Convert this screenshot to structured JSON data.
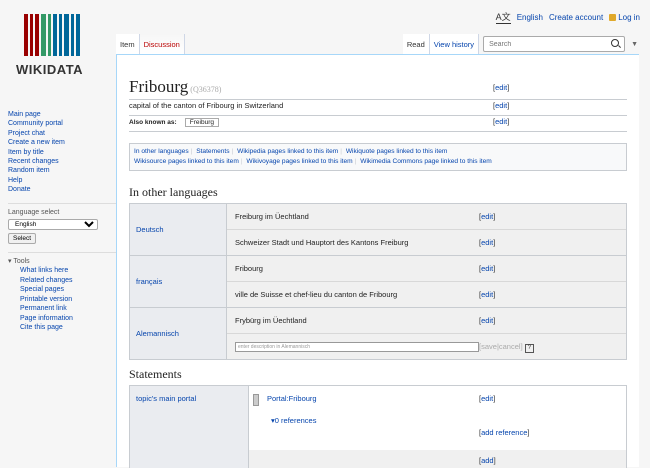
{
  "personal": {
    "language": "English",
    "create_account": "Create account",
    "login": "Log in"
  },
  "logo": {
    "wordmark": "WIKIDATA",
    "bar_colors": [
      "#990000",
      "#990000",
      "#990000",
      "#339966",
      "#339966",
      "#006699",
      "#006699",
      "#006699",
      "#006699",
      "#006699"
    ]
  },
  "sidebar": {
    "nav": [
      "Main page",
      "Community portal",
      "Project chat",
      "Create a new item",
      "Item by title",
      "Recent changes",
      "Random item",
      "Help",
      "Donate"
    ],
    "language_select_title": "Language select",
    "language_selected": "English",
    "select_button": "Select",
    "tools_title": "Tools",
    "tools": [
      "What links here",
      "Related changes",
      "Special pages",
      "Printable version",
      "Permanent link",
      "Page information",
      "Cite this page"
    ]
  },
  "tabs": {
    "item": "Item",
    "discussion": "Discussion",
    "read": "Read",
    "view_history": "View history"
  },
  "search": {
    "placeholder": "Search"
  },
  "item": {
    "label": "Fribourg",
    "qid": "(Q36378)",
    "description": "capital of the canton of Fribourg in Switzerland",
    "also_known_as_label": "Also known as:",
    "alias": "Freiburg"
  },
  "edit": {
    "edit": "edit",
    "save": "save",
    "cancel": "cancel",
    "add_reference": "add reference",
    "add": "add"
  },
  "links": [
    "In other languages",
    "Statements",
    "Wikipedia pages linked to this item",
    "Wikiquote pages linked to this item",
    "Wikisource pages linked to this item",
    "Wikivoyage pages linked to this item",
    "Wikimedia Commons page linked to this item"
  ],
  "languages_heading": "In other languages",
  "languages": [
    {
      "name": "Deutsch",
      "label": "Freiburg im Üechtland",
      "description": "Schweizer Stadt und Hauptort des Kantons Freiburg"
    },
    {
      "name": "français",
      "label": "Fribourg",
      "description": "ville de Suisse et chef-lieu du canton de Fribourg"
    },
    {
      "name": "Alemannisch",
      "label": "Frybürg im Üechtland",
      "description_placeholder": "enter description in Alemannisch"
    }
  ],
  "statements_heading": "Statements",
  "statement": {
    "property": "topic's main portal",
    "value": "Portal:Fribourg",
    "references": "0 references"
  }
}
